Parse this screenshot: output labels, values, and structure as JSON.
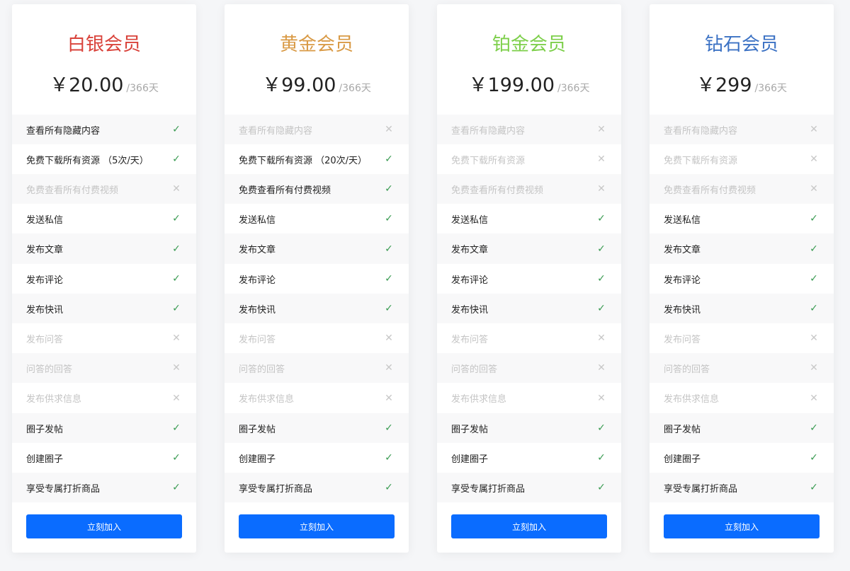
{
  "plans": [
    {
      "title": "白银会员",
      "title_color": "#d9423a",
      "price": "￥20.00",
      "period": "/366天",
      "button_label": "立刻加入",
      "features": [
        {
          "label": "查看所有隐藏内容",
          "enabled": true
        },
        {
          "label": "免费下载所有资源 （5次/天）",
          "enabled": true
        },
        {
          "label": "免费查看所有付费视频",
          "enabled": false
        },
        {
          "label": "发送私信",
          "enabled": true
        },
        {
          "label": "发布文章",
          "enabled": true
        },
        {
          "label": "发布评论",
          "enabled": true
        },
        {
          "label": "发布快讯",
          "enabled": true
        },
        {
          "label": "发布问答",
          "enabled": false
        },
        {
          "label": "问答的回答",
          "enabled": false
        },
        {
          "label": "发布供求信息",
          "enabled": false
        },
        {
          "label": "圈子发帖",
          "enabled": true
        },
        {
          "label": "创建圈子",
          "enabled": true
        },
        {
          "label": "享受专属打折商品",
          "enabled": true
        }
      ]
    },
    {
      "title": "黄金会员",
      "title_color": "#d99a45",
      "price": "￥99.00",
      "period": "/366天",
      "button_label": "立刻加入",
      "features": [
        {
          "label": "查看所有隐藏内容",
          "enabled": false
        },
        {
          "label": "免费下载所有资源 （20次/天）",
          "enabled": true
        },
        {
          "label": "免费查看所有付费视频",
          "enabled": true
        },
        {
          "label": "发送私信",
          "enabled": true
        },
        {
          "label": "发布文章",
          "enabled": true
        },
        {
          "label": "发布评论",
          "enabled": true
        },
        {
          "label": "发布快讯",
          "enabled": true
        },
        {
          "label": "发布问答",
          "enabled": false
        },
        {
          "label": "问答的回答",
          "enabled": false
        },
        {
          "label": "发布供求信息",
          "enabled": false
        },
        {
          "label": "圈子发帖",
          "enabled": true
        },
        {
          "label": "创建圈子",
          "enabled": true
        },
        {
          "label": "享受专属打折商品",
          "enabled": true
        }
      ]
    },
    {
      "title": "铂金会员",
      "title_color": "#7dcf4a",
      "price": "￥199.00",
      "period": "/366天",
      "button_label": "立刻加入",
      "features": [
        {
          "label": "查看所有隐藏内容",
          "enabled": false
        },
        {
          "label": "免费下载所有资源",
          "enabled": false
        },
        {
          "label": "免费查看所有付费视频",
          "enabled": false
        },
        {
          "label": "发送私信",
          "enabled": true
        },
        {
          "label": "发布文章",
          "enabled": true
        },
        {
          "label": "发布评论",
          "enabled": true
        },
        {
          "label": "发布快讯",
          "enabled": true
        },
        {
          "label": "发布问答",
          "enabled": false
        },
        {
          "label": "问答的回答",
          "enabled": false
        },
        {
          "label": "发布供求信息",
          "enabled": false
        },
        {
          "label": "圈子发帖",
          "enabled": true
        },
        {
          "label": "创建圈子",
          "enabled": true
        },
        {
          "label": "享受专属打折商品",
          "enabled": true
        }
      ]
    },
    {
      "title": "钻石会员",
      "title_color": "#3c72c4",
      "price": "￥299",
      "period": "/366天",
      "button_label": "立刻加入",
      "features": [
        {
          "label": "查看所有隐藏内容",
          "enabled": false
        },
        {
          "label": "免费下载所有资源",
          "enabled": false
        },
        {
          "label": "免费查看所有付费视频",
          "enabled": false
        },
        {
          "label": "发送私信",
          "enabled": true
        },
        {
          "label": "发布文章",
          "enabled": true
        },
        {
          "label": "发布评论",
          "enabled": true
        },
        {
          "label": "发布快讯",
          "enabled": true
        },
        {
          "label": "发布问答",
          "enabled": false
        },
        {
          "label": "问答的回答",
          "enabled": false
        },
        {
          "label": "发布供求信息",
          "enabled": false
        },
        {
          "label": "圈子发帖",
          "enabled": true
        },
        {
          "label": "创建圈子",
          "enabled": true
        },
        {
          "label": "享受专属打折商品",
          "enabled": true
        }
      ]
    }
  ],
  "icons": {
    "enabled": "check-icon",
    "disabled": "cross-icon"
  },
  "colors": {
    "button": "#0a6cff",
    "check": "#3a9b52",
    "cross": "#c8c8c8"
  }
}
